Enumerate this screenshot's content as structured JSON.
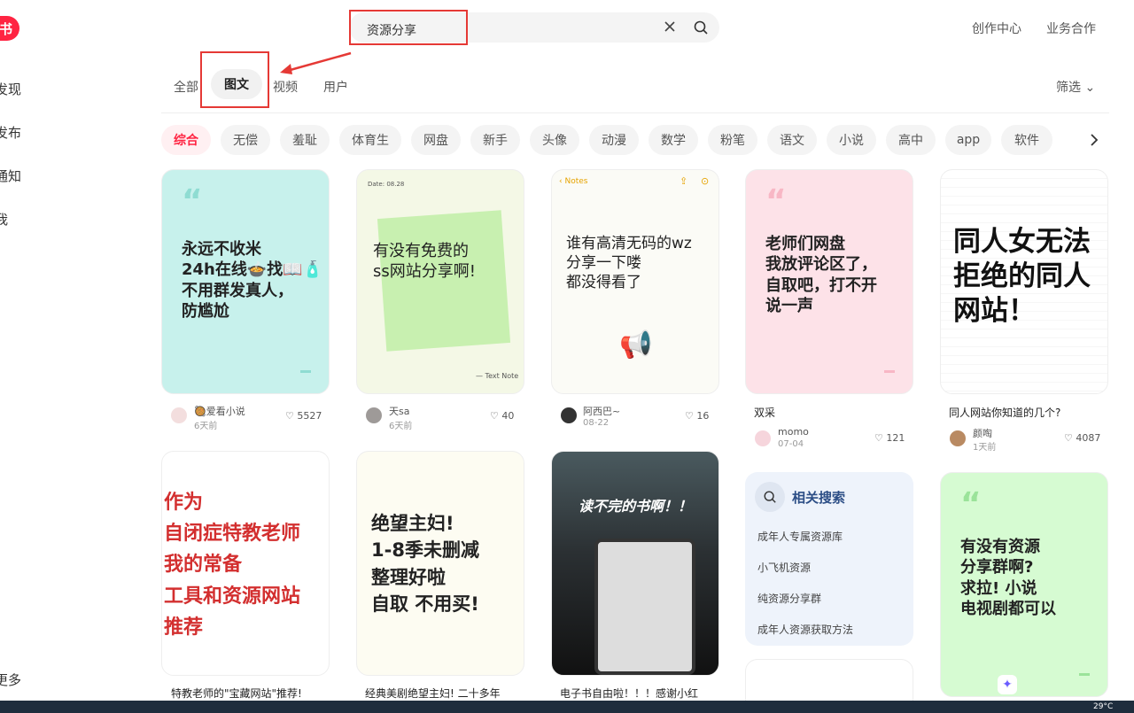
{
  "logo": {
    "text": "书"
  },
  "sidebar": {
    "items": [
      {
        "label": "发现"
      },
      {
        "label": "发布"
      },
      {
        "label": "通知"
      },
      {
        "label": "我"
      }
    ],
    "more": "更多"
  },
  "search": {
    "value": "资源分享"
  },
  "header": {
    "links": [
      "创作中心",
      "业务合作"
    ]
  },
  "tabs": [
    {
      "label": "全部"
    },
    {
      "label": "图文"
    },
    {
      "label": "视频"
    },
    {
      "label": "用户"
    }
  ],
  "filter": {
    "label": "筛选"
  },
  "chips": [
    "综合",
    "无偿",
    "羞耻",
    "体育生",
    "网盘",
    "新手",
    "头像",
    "动漫",
    "数学",
    "粉笔",
    "语文",
    "小说",
    "高中",
    "app",
    "软件"
  ],
  "cards": [
    {
      "text": "永远不收米\n24h在线🍲找📖🧴\n不用群发真人，\n防尴尬",
      "author": "🥘爱看小说",
      "date": "6天前",
      "likes": "5527",
      "caption": ""
    },
    {
      "text": "有没有免费的\nss网站分享啊!",
      "author": "天sa",
      "date": "6天前",
      "likes": "40",
      "caption": "",
      "date_note": "Date: 08.28",
      "foot_note": "— Text Note"
    },
    {
      "text": "谁有高清无码的wz\n分享一下喽\n都没得看了",
      "author": "阿西巴~",
      "date": "08-22",
      "likes": "16",
      "caption": "",
      "notes_label": "Notes"
    },
    {
      "text": "老师们网盘\n我放评论区了，\n自取吧，打不开\n说一声",
      "author": "momo",
      "date": "07-04",
      "likes": "121",
      "caption": "双采"
    },
    {
      "text": "同人女无法\n拒绝的同人\n网站！",
      "author": "颜啕",
      "date": "1天前",
      "likes": "4087",
      "caption": "同人网站你知道的几个?"
    },
    {
      "text": "作为\n自闭症特教老师\n我的常备\n工具和资源网站\n推荐",
      "caption": "特教老师的\"宝藏网站\"推荐!"
    },
    {
      "text": "绝望主妇!\n1-8季未删减\n整理好啦\n自取 不用买!",
      "caption": "经典美剧绝望主妇! 二十多年"
    },
    {
      "text": "读不完的书啊！！",
      "caption": "电子书自由啦！！！感谢小红"
    },
    {
      "text": "有没有资源\n分享群啊?\n求拉! 小说\n电视剧都可以",
      "caption": ""
    }
  ],
  "related": {
    "title": "相关搜索",
    "items": [
      "成年人专属资源库",
      "小飞机资源",
      "纯资源分享群",
      "成年人资源获取方法"
    ]
  },
  "taskbar": {
    "weather": "29°C"
  }
}
